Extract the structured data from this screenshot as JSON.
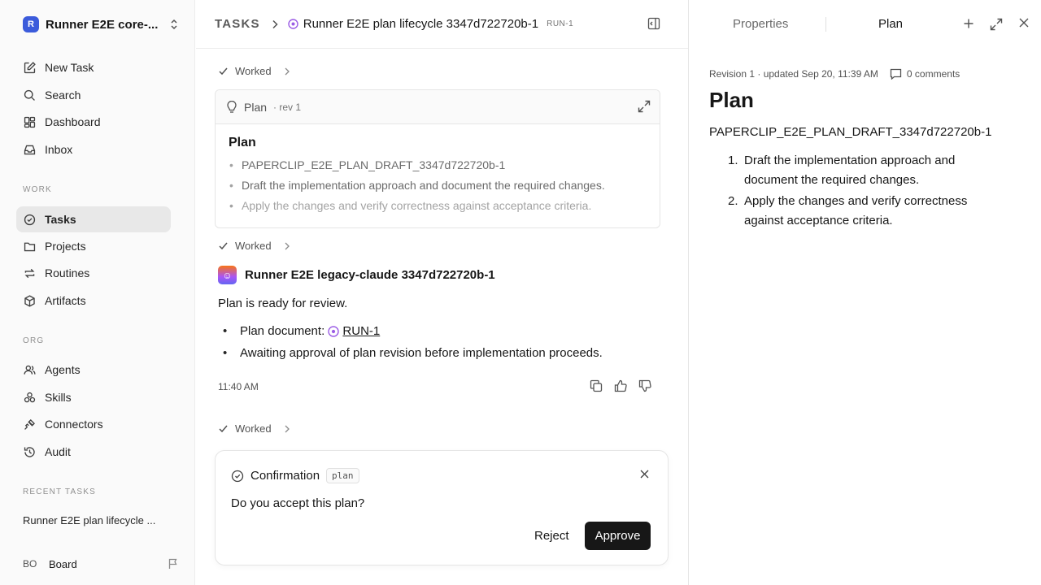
{
  "sidebar": {
    "workspace": {
      "logo": "R",
      "name": "Runner E2E core-..."
    },
    "nav": [
      {
        "label": "New Task",
        "icon": "edit-icon"
      },
      {
        "label": "Search",
        "icon": "search-icon"
      },
      {
        "label": "Dashboard",
        "icon": "dashboard-icon"
      },
      {
        "label": "Inbox",
        "icon": "inbox-icon"
      }
    ],
    "work_label": "WORK",
    "work": [
      {
        "label": "Tasks",
        "icon": "check-circle-icon",
        "active": true
      },
      {
        "label": "Projects",
        "icon": "folder-icon"
      },
      {
        "label": "Routines",
        "icon": "repeat-icon"
      },
      {
        "label": "Artifacts",
        "icon": "box-icon"
      }
    ],
    "org_label": "ORG",
    "org": [
      {
        "label": "Agents",
        "icon": "users-icon"
      },
      {
        "label": "Skills",
        "icon": "skills-icon"
      },
      {
        "label": "Connectors",
        "icon": "plug-icon"
      },
      {
        "label": "Audit",
        "icon": "history-icon"
      }
    ],
    "recent_label": "RECENT TASKS",
    "recent_task": "Runner E2E plan lifecycle ...",
    "board": {
      "avatar": "BO",
      "label": "Board"
    }
  },
  "header": {
    "root": "TASKS",
    "task_title": "Runner E2E plan lifecycle 3347d722720b-1",
    "task_id": "RUN-1"
  },
  "thread": {
    "worked_label": "Worked",
    "plan_card": {
      "title": "Plan",
      "rev": "· rev 1",
      "heading": "Plan",
      "items": [
        "PAPERCLIP_E2E_PLAN_DRAFT_3347d722720b-1",
        "Draft the implementation approach and document the required changes.",
        "Apply the changes and verify correctness against acceptance criteria."
      ]
    },
    "agent": {
      "name": "Runner E2E legacy-claude 3347d722720b-1",
      "avatar": "☺"
    },
    "message": "Plan is ready for review.",
    "bullet1_prefix": "Plan document: ",
    "bullet1_link": "RUN-1",
    "bullet2": "Awaiting approval of plan revision before implementation proceeds.",
    "time": "11:40 AM"
  },
  "confirmation": {
    "title": "Confirmation",
    "tag": "plan",
    "question": "Do you accept this plan?",
    "reject_label": "Reject",
    "approve_label": "Approve"
  },
  "right_panel": {
    "tab_properties": "Properties",
    "tab_plan": "Plan",
    "meta": "Revision 1 · updated Sep 20, 11:39 AM",
    "comments": "0 comments",
    "title": "Plan",
    "draft": "PAPERCLIP_E2E_PLAN_DRAFT_3347d722720b-1",
    "steps": [
      {
        "num": "1.",
        "text": "Draft the implementation approach and document the required changes."
      },
      {
        "num": "2.",
        "text": "Apply the changes and verify correctness against acceptance criteria."
      }
    ]
  },
  "colors": {
    "accent": "#171717",
    "brand": "#3b5bdb",
    "run_icon": "#9b5de5"
  }
}
